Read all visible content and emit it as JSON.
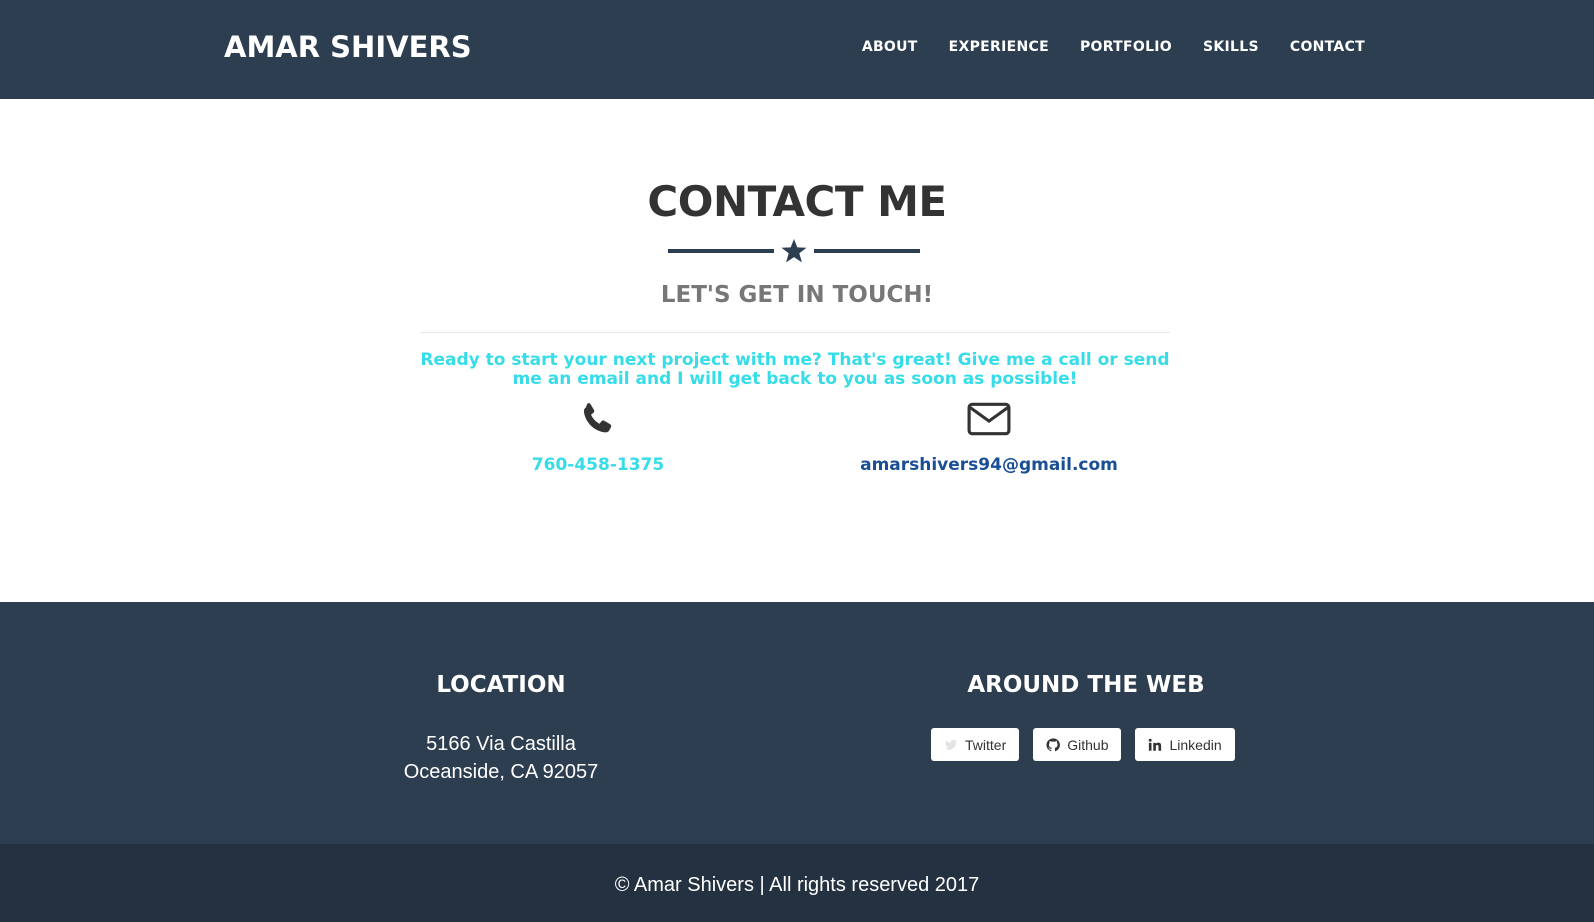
{
  "nav": {
    "brand": "AMAR SHIVERS",
    "links": [
      "ABOUT",
      "EXPERIENCE",
      "PORTFOLIO",
      "SKILLS",
      "CONTACT"
    ]
  },
  "contact": {
    "title": "CONTACT ME",
    "divider_icon": "star-icon",
    "subtitle": "LET'S GET IN TOUCH!",
    "intro": "Ready to start your next project with me? That's great! Give me a call or send me an email and I will get back to you as soon as possible!",
    "phone_icon": "phone-icon",
    "phone": "760-458-1375",
    "email_icon": "envelope-icon",
    "email": "amarshivers94@gmail.com"
  },
  "footer": {
    "location_title": "LOCATION",
    "address_line1": "5166 Via Castilla",
    "address_line2": "Oceanside, CA 92057",
    "web_title": "AROUND THE WEB",
    "social": [
      {
        "label": "Twitter",
        "icon": "twitter-icon"
      },
      {
        "label": "Github",
        "icon": "github-icon"
      },
      {
        "label": "Linkedin",
        "icon": "linkedin-icon"
      }
    ]
  },
  "copyright": "© Amar Shivers | All rights reserved 2017",
  "colors": {
    "primary": "#2c3e50",
    "copyright_bg": "#233140",
    "accent_cyan": "#36dde8",
    "email_link": "#1a4e95",
    "heading": "#333333",
    "subtitle": "#777777"
  }
}
